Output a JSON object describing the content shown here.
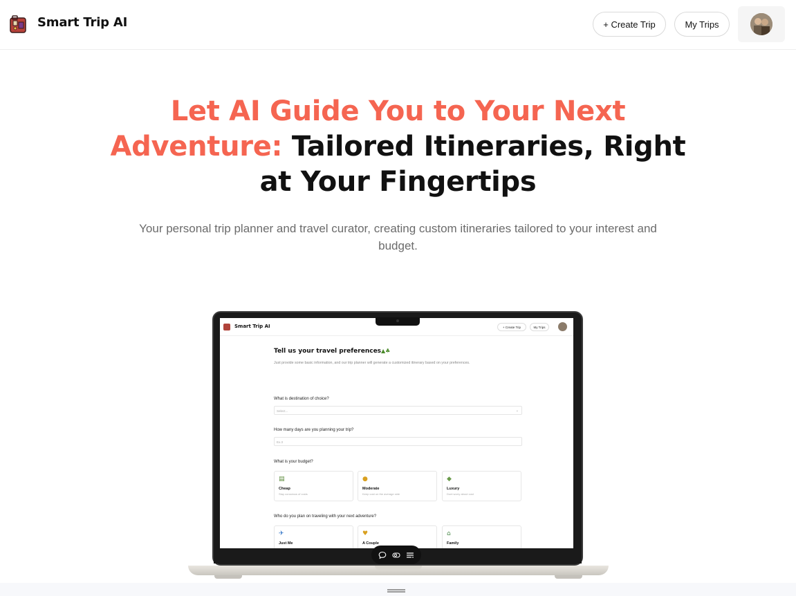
{
  "header": {
    "logo_text": "Smart Trip AI",
    "create_trip_label": "+ Create Trip",
    "my_trips_label": "My Trips"
  },
  "hero": {
    "title_accent": "Let AI Guide You to Your Next Adventure:",
    "title_rest": "Tailored Itineraries, Right at Your Fingertips",
    "subtitle": "Your personal trip planner and travel curator, creating custom itineraries tailored to your interest and budget."
  },
  "mockup": {
    "logo_text": "Smart Trip AI",
    "create_trip_label": "+ Create Trip",
    "my_trips_label": "My Trips",
    "title": "Tell us your travel preferences",
    "subtitle": "Just provide some basic information, and our trip planner will generate a customized itinerary based on your preferences.",
    "q_destination": "What is destination of choice?",
    "destination_placeholder": "Select...",
    "q_days": "How many days are you planning your trip?",
    "days_placeholder": "Ex.3",
    "q_budget": "What is your budget?",
    "budget_options": [
      {
        "icon": "money-icon",
        "title": "Cheap",
        "desc": "Stay conscious of costs"
      },
      {
        "icon": "money-bag-icon",
        "title": "Moderate",
        "desc": "Keep cost on the average side"
      },
      {
        "icon": "luxury-icon",
        "title": "Luxury",
        "desc": "Dont worry about cost"
      }
    ],
    "q_travelers": "Who do you plan on traveling with your next adventure?",
    "traveler_options": [
      {
        "icon": "airplane-icon",
        "title": "Just Me"
      },
      {
        "icon": "couple-icon",
        "title": "A Couple"
      },
      {
        "icon": "house-icon",
        "title": "Family"
      }
    ]
  },
  "colors": {
    "accent": "#f56551",
    "text": "#111111",
    "muted": "#6b6b6b"
  }
}
